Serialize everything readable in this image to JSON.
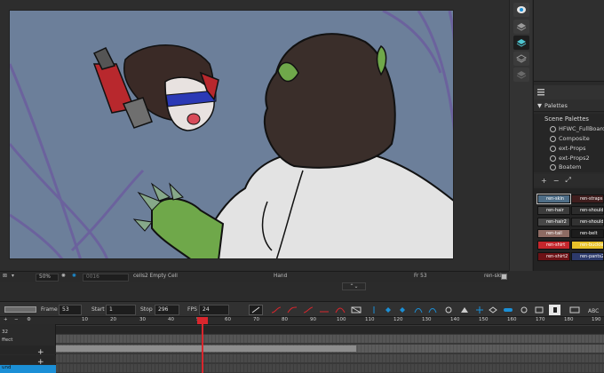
{
  "status_bar": {
    "zoom": "50%",
    "drawing_field": "0016",
    "layer_info": "cells2 Empty Cell",
    "tool": "Hand",
    "frame": "Fr 53",
    "drawing": "ren-skin",
    "resize_handle": "⌃⌄"
  },
  "right_toolstrip": {
    "icons": [
      "eye-icon",
      "layer-icon",
      "layers-stack-icon",
      "layers-outline-icon",
      "layers-dim-icon"
    ]
  },
  "palettes_panel": {
    "header": "Palettes",
    "section_title": "Scene Palettes",
    "items": [
      "HFWC_FullBoard",
      "Composite",
      "ext-Props",
      "ext-Props2",
      "Boatem"
    ],
    "toolbar": [
      "+",
      "−",
      "⤢"
    ],
    "swatches": [
      {
        "name": "ren-skin",
        "color": "#4e6d86",
        "selected": true
      },
      {
        "name": "ren-straps",
        "color": "#3f1d1d"
      },
      {
        "name": "ren-hair",
        "color": "#3c3c3c"
      },
      {
        "name": "ren-shoulderpa",
        "color": "#2c2c2c"
      },
      {
        "name": "ren-hair2",
        "color": "#474747"
      },
      {
        "name": "ren-shoulderpa",
        "color": "#323232"
      },
      {
        "name": "ren-tail",
        "color": "#8d6b63"
      },
      {
        "name": "ren-belt",
        "color": "#1d1d1d"
      },
      {
        "name": "ren-shirt",
        "color": "#c5262c"
      },
      {
        "name": "ren-buckle",
        "color": "#e8c22a"
      },
      {
        "name": "ren-shirt2",
        "color": "#6d1216"
      },
      {
        "name": "ren-pants2",
        "color": "#2d3a6b"
      }
    ]
  },
  "timeline_toolbar": {
    "frame_label": "Frame",
    "frame_value": "53",
    "start_label": "Start",
    "start_value": "1",
    "stop_label": "Stop",
    "stop_value": "296",
    "fps_label": "FPS",
    "fps_value": "24"
  },
  "timeline": {
    "layers": [
      "32",
      "ffect",
      "",
      "",
      "und"
    ],
    "ruler_numbers": [
      "10",
      "20",
      "30",
      "40",
      "50",
      "60",
      "70",
      "80",
      "90",
      "100",
      "110",
      "120",
      "130",
      "140",
      "150",
      "160",
      "170",
      "180",
      "190"
    ]
  },
  "colors": {
    "viewport_bg": "#6c7f9a",
    "playhead": "#d9262d",
    "accent_blue": "#1b8fd6"
  }
}
